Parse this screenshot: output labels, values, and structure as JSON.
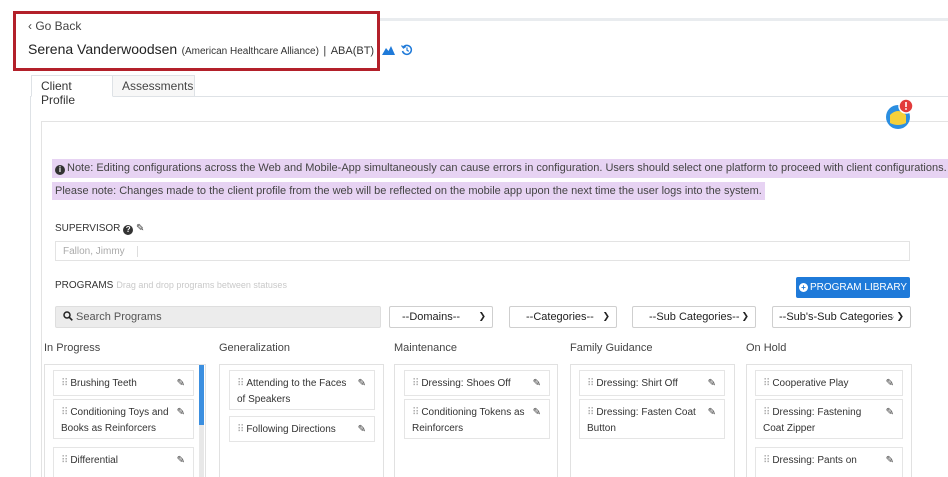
{
  "header": {
    "back_label": "‹ Go Back",
    "client_name": "Serena Vanderwoodsen",
    "organization": "(American Healthcare Alliance)",
    "separator": "|",
    "program_type": "ABA(BT)"
  },
  "tabs": [
    {
      "label": "Client Profile",
      "active": true
    },
    {
      "label": "Assessments",
      "active": false
    }
  ],
  "notes": {
    "note1": "Note: Editing configurations across the Web and Mobile-App simultaneously can cause errors in configuration. Users should select one platform to proceed with client configurations.",
    "note2": "Please note: Changes made to the client profile from the web will be reflected on the mobile app upon the next time the user logs into the system."
  },
  "supervisor": {
    "label": "SUPERVISOR",
    "value": "Fallon, Jimmy"
  },
  "programs": {
    "label": "PROGRAMS",
    "hint": "Drag and drop programs between statuses",
    "library_button": "PROGRAM LIBRARY",
    "search_placeholder": "Search Programs",
    "filters": [
      "--Domains--",
      "--Categories--",
      "--Sub Categories--",
      "--Sub's-Sub Categories-"
    ]
  },
  "columns": [
    {
      "title": "In Progress",
      "items": [
        "Brushing Teeth",
        "Conditioning Toys and Books as Reinforcers",
        "Differential"
      ]
    },
    {
      "title": "Generalization",
      "items": [
        "Attending to the Faces of Speakers",
        "Following Directions"
      ]
    },
    {
      "title": "Maintenance",
      "items": [
        "Dressing: Shoes Off",
        "Conditioning Tokens as Reinforcers"
      ]
    },
    {
      "title": "Family Guidance",
      "items": [
        "Dressing: Shirt Off",
        "Dressing: Fasten Coat Button"
      ]
    },
    {
      "title": "On Hold",
      "items": [
        "Cooperative Play",
        "Dressing: Fastening Coat Zipper",
        "Dressing: Pants on"
      ]
    }
  ],
  "colors": {
    "accent": "#1f7ad9",
    "highlight_border": "#b3202a",
    "note_background": "#e7d3f3"
  }
}
